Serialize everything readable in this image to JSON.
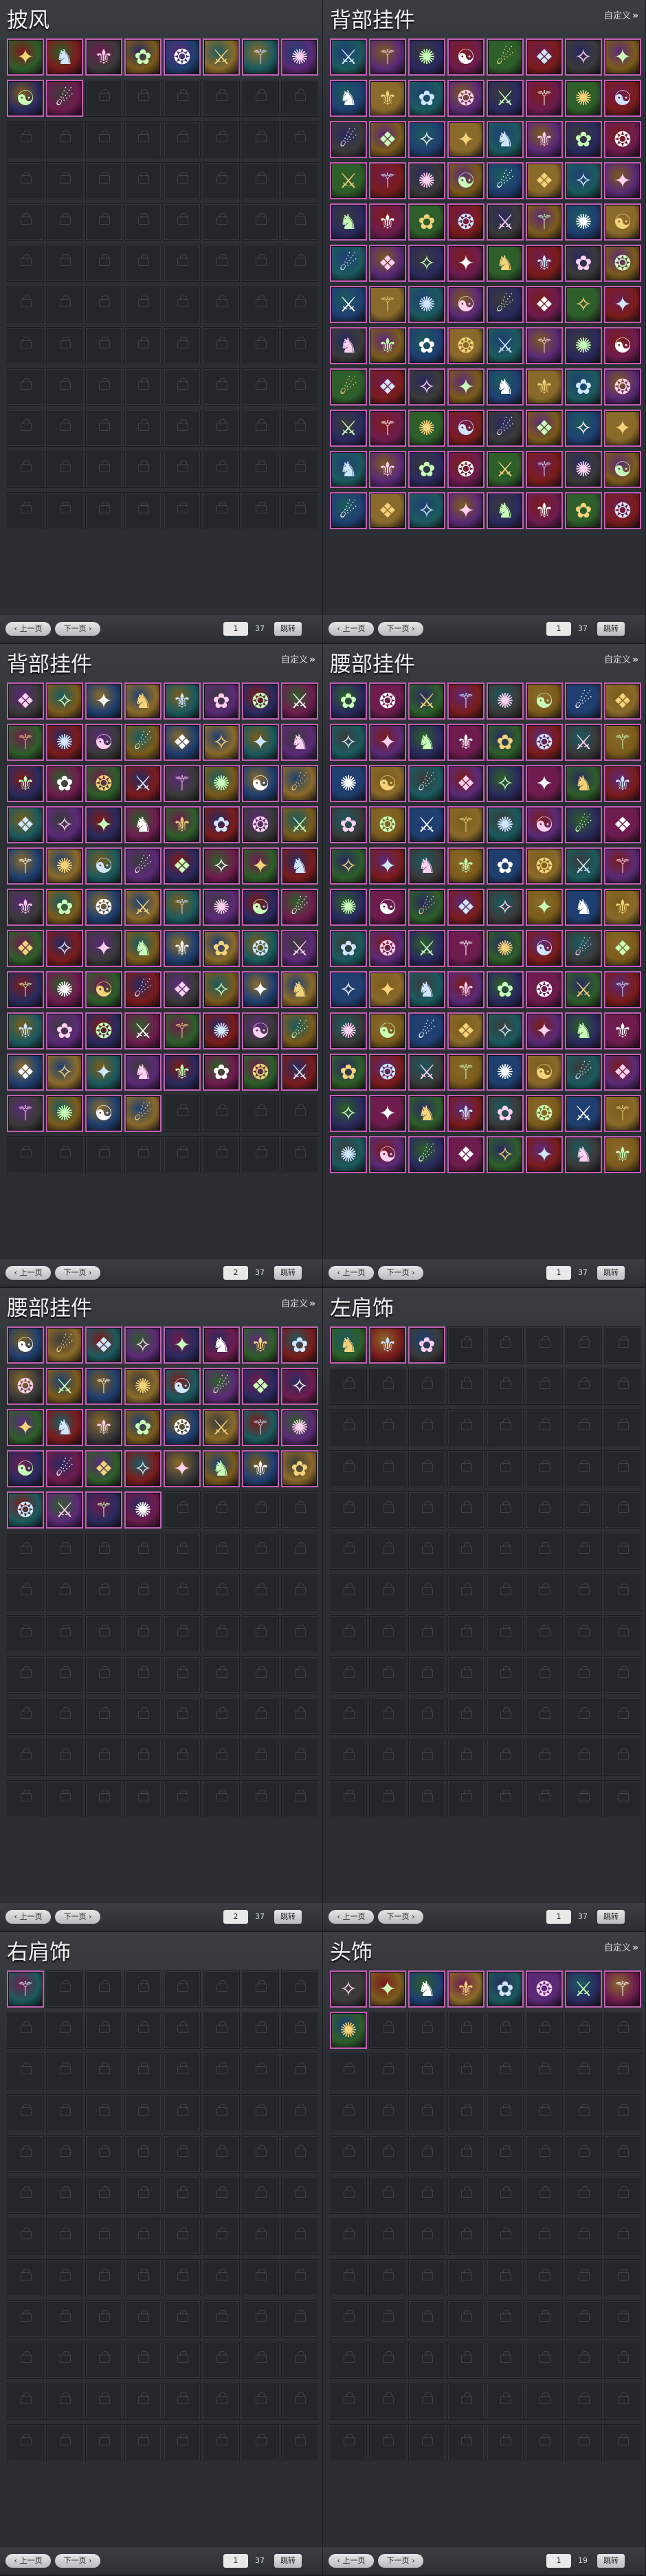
{
  "common": {
    "customize_label": "自定义",
    "prev_label": "上一页",
    "next_label": "下一页",
    "jump_label": "跳转"
  },
  "colors": {
    "slot_border_filled": "#c061b4",
    "panel_bg": "#2b2e32",
    "pager_bg": "#3b3f44"
  },
  "item_icon_palette": [
    "#7a1c1c",
    "#1f3f70",
    "#5b2a76",
    "#2e5e2a",
    "#7a5b1c",
    "#1c5a5e",
    "#6e1c4e",
    "#3a3a3a",
    "#8a6a2a",
    "#2a2a5e"
  ],
  "item_glyphs": [
    "✦",
    "⚔",
    "❖",
    "✿",
    "☯",
    "♞",
    "⚚",
    "✧",
    "❂",
    "☄",
    "⚜",
    "✺"
  ],
  "panels": [
    {
      "title": "披风",
      "show_custom": false,
      "page": "1",
      "total": "37",
      "filled": 10
    },
    {
      "title": "背部挂件",
      "show_custom": true,
      "page": "1",
      "total": "37",
      "filled": 96
    },
    {
      "title": "背部挂件",
      "show_custom": true,
      "page": "2",
      "total": "37",
      "filled": 84
    },
    {
      "title": "腰部挂件",
      "show_custom": true,
      "page": "1",
      "total": "37",
      "filled": 96
    },
    {
      "title": "腰部挂件",
      "show_custom": true,
      "page": "2",
      "total": "37",
      "filled": 36
    },
    {
      "title": "左肩饰",
      "show_custom": false,
      "page": "1",
      "total": "37",
      "filled": 3
    },
    {
      "title": "右肩饰",
      "show_custom": false,
      "page": "1",
      "total": "37",
      "filled": 1
    },
    {
      "title": "头饰",
      "show_custom": true,
      "page": "1",
      "total": "19",
      "filled": 9
    }
  ]
}
